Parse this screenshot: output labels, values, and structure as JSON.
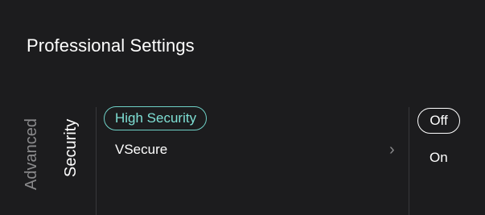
{
  "header": {
    "title": "Professional Settings"
  },
  "tabs": [
    {
      "label": "Advanced",
      "active": false
    },
    {
      "label": "Security",
      "active": true
    }
  ],
  "menu": {
    "items": [
      {
        "label": "High Security",
        "selected": true
      },
      {
        "label": "VSecure",
        "selected": false
      }
    ]
  },
  "submenu_icon": "chevron-right-icon",
  "options": {
    "items": [
      {
        "label": "Off",
        "selected": true
      },
      {
        "label": "On",
        "selected": false
      }
    ]
  },
  "colors": {
    "background": "#1c1c1e",
    "accent": "#6fd1c7",
    "text": "#ffffff",
    "muted_text": "#8a8a8c"
  }
}
